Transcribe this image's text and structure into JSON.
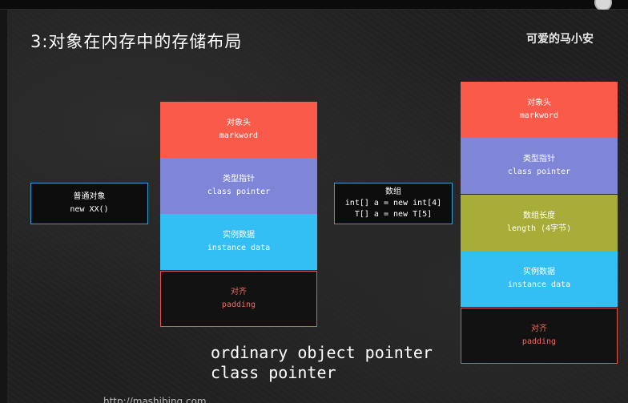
{
  "slide": {
    "title": "3:对象在内存中的存储布局",
    "watermark": "可爱的马小安",
    "url": "http://mashibing.com"
  },
  "ordinary_object": {
    "label": {
      "line1": "普通对象",
      "line2": "new XX()"
    },
    "layout": {
      "header": {
        "line1": "对象头",
        "line2": "markword"
      },
      "class_pointer": {
        "line1": "类型指针",
        "line2": "class pointer"
      },
      "instance_data": {
        "line1": "实例数据",
        "line2": "instance data"
      },
      "padding": {
        "line1": "对齐",
        "line2": "padding"
      }
    }
  },
  "array_object": {
    "label": {
      "line1": "数组",
      "line2": "int[] a = new int[4]",
      "line3": "T[] a = new T[5]"
    },
    "layout": {
      "header": {
        "line1": "对象头",
        "line2": "markword"
      },
      "class_pointer": {
        "line1": "类型指针",
        "line2": "class pointer"
      },
      "length": {
        "line1": "数组长度",
        "line2": "length (4字节)"
      },
      "instance_data": {
        "line1": "实例数据",
        "line2": "instance data"
      },
      "padding": {
        "line1": "对齐",
        "line2": "padding"
      }
    }
  },
  "caption": {
    "line1": "ordinary object pointer",
    "line2": "class pointer"
  },
  "colors": {
    "header": "#fa5a4a",
    "class_pointer": "#7f86d8",
    "instance_data": "#33bef4",
    "length": "#a7ad38",
    "padding_border": "#e2584c",
    "label_border": "#3a9bd0"
  }
}
